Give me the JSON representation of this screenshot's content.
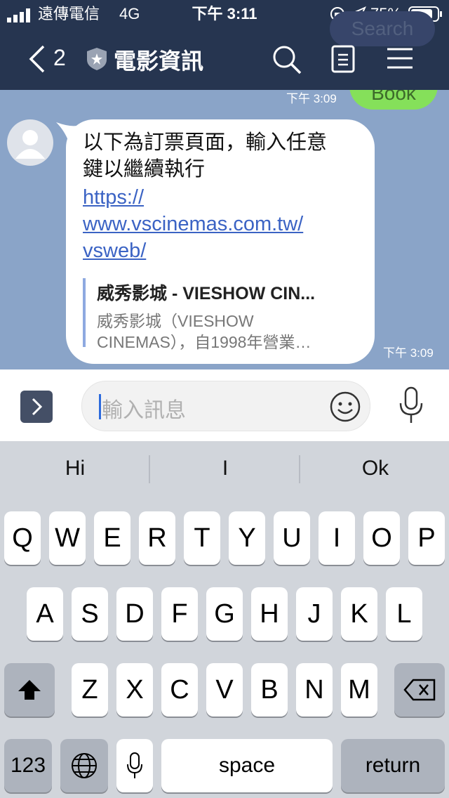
{
  "status": {
    "carrier": "遠傳電信",
    "network": "4G",
    "time": "下午 3:11",
    "battery": "75%"
  },
  "header": {
    "back_count": "2",
    "title": "電影資訊"
  },
  "behind": {
    "search": "Search",
    "book": "Book"
  },
  "chat": {
    "sent_time": "下午 3:09",
    "message": {
      "text": "以下為訂票頁面，輸入任意鍵以繼續執行",
      "link_lines": [
        "https://",
        "www.vscinemas.com.tw/",
        "vsweb/"
      ],
      "preview_title": "威秀影城 - VIESHOW CIN...",
      "preview_desc_1": "威秀影城（VIESHOW",
      "preview_desc_2": "CINEMAS），自1998年營業…",
      "time": "下午 3:09"
    }
  },
  "input": {
    "placeholder": "輸入訊息"
  },
  "keyboard": {
    "suggestions": [
      "Hi",
      "I",
      "Ok"
    ],
    "row1": [
      "Q",
      "W",
      "E",
      "R",
      "T",
      "Y",
      "U",
      "I",
      "O",
      "P"
    ],
    "row2": [
      "A",
      "S",
      "D",
      "F",
      "G",
      "H",
      "J",
      "K",
      "L"
    ],
    "row3": [
      "Z",
      "X",
      "C",
      "V",
      "B",
      "N",
      "M"
    ],
    "num": "123",
    "space": "space",
    "return": "return"
  }
}
